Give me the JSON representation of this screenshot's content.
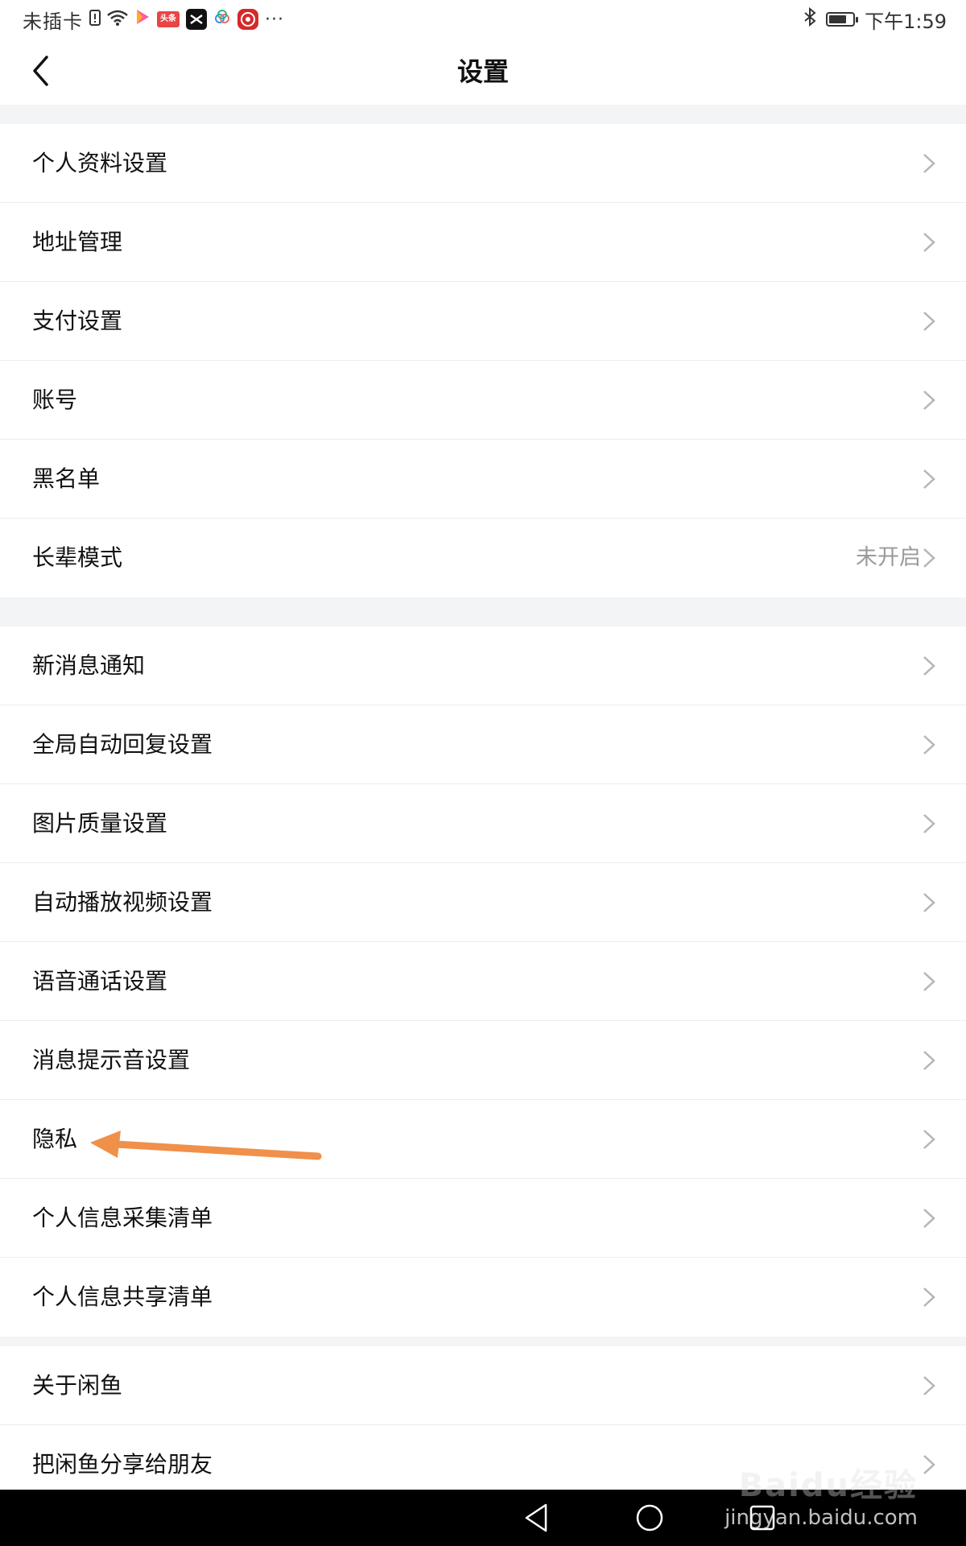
{
  "status_bar": {
    "carrier": "未插卡",
    "toutiao_label": "头条",
    "time": "下午1:59",
    "more_dots": "···"
  },
  "header": {
    "title": "设置"
  },
  "groups": [
    {
      "items": [
        {
          "label": "个人资料设置",
          "value": ""
        },
        {
          "label": "地址管理",
          "value": ""
        },
        {
          "label": "支付设置",
          "value": ""
        },
        {
          "label": "账号",
          "value": ""
        },
        {
          "label": "黑名单",
          "value": ""
        },
        {
          "label": "长辈模式",
          "value": "未开启"
        }
      ]
    },
    {
      "items": [
        {
          "label": "新消息通知",
          "value": ""
        },
        {
          "label": "全局自动回复设置",
          "value": ""
        },
        {
          "label": "图片质量设置",
          "value": ""
        },
        {
          "label": "自动播放视频设置",
          "value": ""
        },
        {
          "label": "语音通话设置",
          "value": ""
        },
        {
          "label": "消息提示音设置",
          "value": ""
        },
        {
          "label": "隐私",
          "value": ""
        },
        {
          "label": "个人信息采集清单",
          "value": ""
        },
        {
          "label": "个人信息共享清单",
          "value": ""
        }
      ]
    },
    {
      "items": [
        {
          "label": "关于闲鱼",
          "value": ""
        },
        {
          "label": "把闲鱼分享给朋友",
          "value": ""
        }
      ]
    }
  ],
  "annotation": {
    "color": "#f0904a"
  },
  "watermark": {
    "logo": "Baidu经验",
    "url": "jingyan.baidu.com"
  },
  "colors": {
    "background": "#f3f4f6",
    "row": "#ffffff",
    "text": "#111111",
    "secondary_text": "#9a9a9a",
    "chevron": "#b5b5b5"
  }
}
